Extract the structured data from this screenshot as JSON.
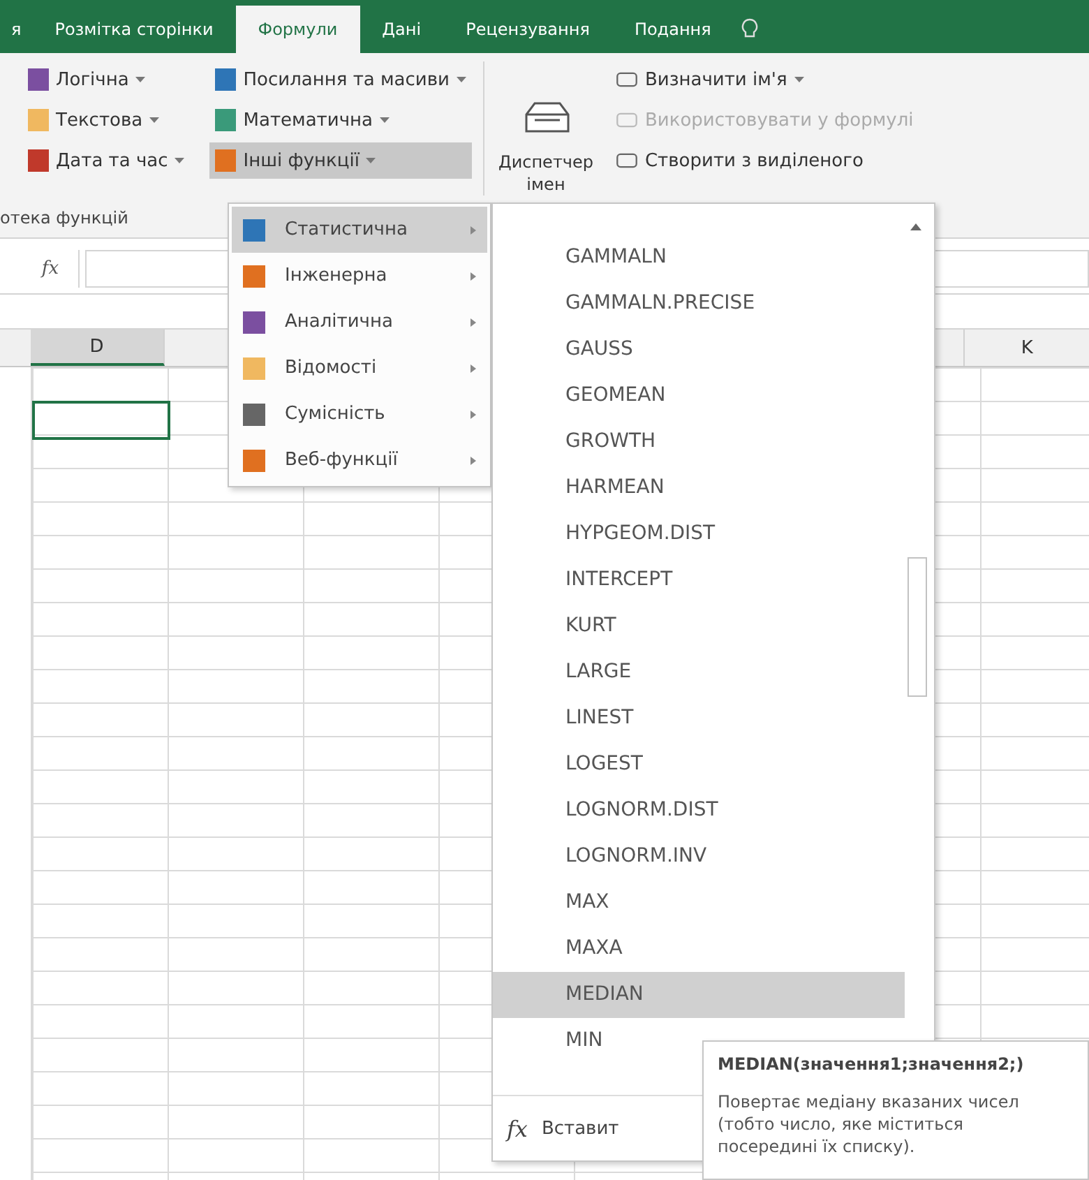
{
  "tabs": [
    {
      "label": "я",
      "selected": false
    },
    {
      "label": "Розмітка сторінки",
      "selected": false
    },
    {
      "label": "Формули",
      "selected": true
    },
    {
      "label": "Дані",
      "selected": false
    },
    {
      "label": "Рецензування",
      "selected": false
    },
    {
      "label": "Подання",
      "selected": false
    }
  ],
  "ribbon": {
    "columns": [
      [
        {
          "label": "Логічна",
          "dropdown": true,
          "selected": false
        },
        {
          "label": "Текстова",
          "dropdown": true,
          "selected": false
        },
        {
          "label": "Дата та час",
          "dropdown": true,
          "selected": false
        }
      ],
      [
        {
          "label": "Посилання та масиви",
          "dropdown": true,
          "selected": false
        },
        {
          "label": "Математична",
          "dropdown": true,
          "selected": false
        },
        {
          "label": "Інші функції",
          "dropdown": true,
          "selected": true
        }
      ]
    ],
    "big_button": {
      "label": "Диспетчер імен"
    },
    "names": [
      {
        "label": "Визначити ім'я",
        "dropdown": true,
        "disabled": false
      },
      {
        "label": "Використовувати у формулі",
        "dropdown": false,
        "disabled": true
      },
      {
        "label": "Створити з виділеного",
        "dropdown": false,
        "disabled": false
      }
    ],
    "group_label": "отека функцій"
  },
  "formula_bar": {
    "fx": "fx"
  },
  "columns": [
    {
      "label": "D",
      "selected": true
    },
    {
      "label": "K",
      "selected": false
    }
  ],
  "submenu": [
    {
      "label": "Статистична",
      "selected": true,
      "color": "#2e75b6"
    },
    {
      "label": "Інженерна",
      "selected": false,
      "color": "#e07020"
    },
    {
      "label": "Аналітична",
      "selected": false,
      "color": "#7b4fa0"
    },
    {
      "label": "Відомості",
      "selected": false,
      "color": "#f0b860"
    },
    {
      "label": "Сумісність",
      "selected": false,
      "color": "#666666"
    },
    {
      "label": "Веб-функції",
      "selected": false,
      "color": "#e07020"
    }
  ],
  "functions": [
    {
      "label": "GAMMALN",
      "selected": false
    },
    {
      "label": "GAMMALN.PRECISE",
      "selected": false
    },
    {
      "label": "GAUSS",
      "selected": false
    },
    {
      "label": "GEOMEAN",
      "selected": false
    },
    {
      "label": "GROWTH",
      "selected": false
    },
    {
      "label": "HARMEAN",
      "selected": false
    },
    {
      "label": "HYPGEOM.DIST",
      "selected": false
    },
    {
      "label": "INTERCEPT",
      "selected": false
    },
    {
      "label": "KURT",
      "selected": false
    },
    {
      "label": "LARGE",
      "selected": false
    },
    {
      "label": "LINEST",
      "selected": false
    },
    {
      "label": "LOGEST",
      "selected": false
    },
    {
      "label": "LOGNORM.DIST",
      "selected": false
    },
    {
      "label": "LOGNORM.INV",
      "selected": false
    },
    {
      "label": "MAX",
      "selected": false
    },
    {
      "label": "MAXA",
      "selected": false
    },
    {
      "label": "MEDIAN",
      "selected": true
    },
    {
      "label": "MIN",
      "selected": false
    }
  ],
  "insert_function": {
    "icon": "fx",
    "label": "Вставит"
  },
  "tooltip": {
    "title": "MEDIAN(значення1;значення2;)",
    "text": "Повертає медіану вказаних чисел (тобто число, яке міститься посередині їх списку)."
  }
}
